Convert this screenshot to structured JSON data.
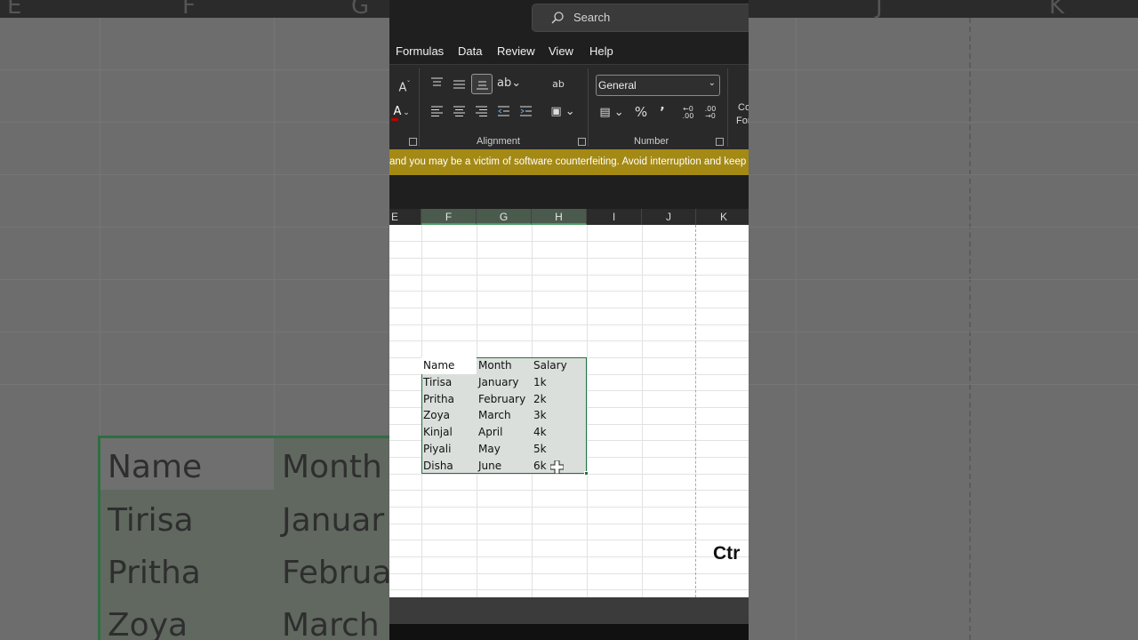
{
  "background": {
    "columns": [
      "E",
      "F",
      "G",
      "J",
      "K"
    ],
    "cells": [
      {
        "col0": "Name",
        "col1": "Month"
      },
      {
        "col0": "Tirisa",
        "col1": "Januar"
      },
      {
        "col0": "Pritha",
        "col1": "Februa"
      },
      {
        "col0": "Zoya",
        "col1": "March"
      }
    ]
  },
  "titlebar": {
    "search_placeholder": "Search"
  },
  "menu": {
    "items": [
      "Formulas",
      "Data",
      "Review",
      "View",
      "Help"
    ]
  },
  "ribbon": {
    "alignment_label": "Alignment",
    "number_label": "Number",
    "number_format_value": "General",
    "partial_label_1": "Co",
    "partial_label_2": "For",
    "accent_color": "#c00000"
  },
  "warning": {
    "text": "and you may be a victim of software counterfeiting. Avoid interruption and keep"
  },
  "grid": {
    "columns": [
      "E",
      "F",
      "G",
      "H",
      "I",
      "J",
      "K"
    ],
    "selected_columns": [
      "F",
      "G",
      "H"
    ],
    "table": {
      "headers": [
        "Name",
        "Month",
        "Salary"
      ],
      "rows": [
        [
          "Tirisa",
          "January",
          "1k"
        ],
        [
          "Pritha",
          "February",
          "2k"
        ],
        [
          "Zoya",
          "March",
          "3k"
        ],
        [
          "Kinjal",
          "April",
          "4k"
        ],
        [
          "Piyali",
          "May",
          "5k"
        ],
        [
          "Disha",
          "June",
          "6k"
        ]
      ]
    },
    "overlay_text": "Ctr"
  },
  "colors": {
    "selection_border": "#217346",
    "warning_bg": "#a48a14"
  }
}
